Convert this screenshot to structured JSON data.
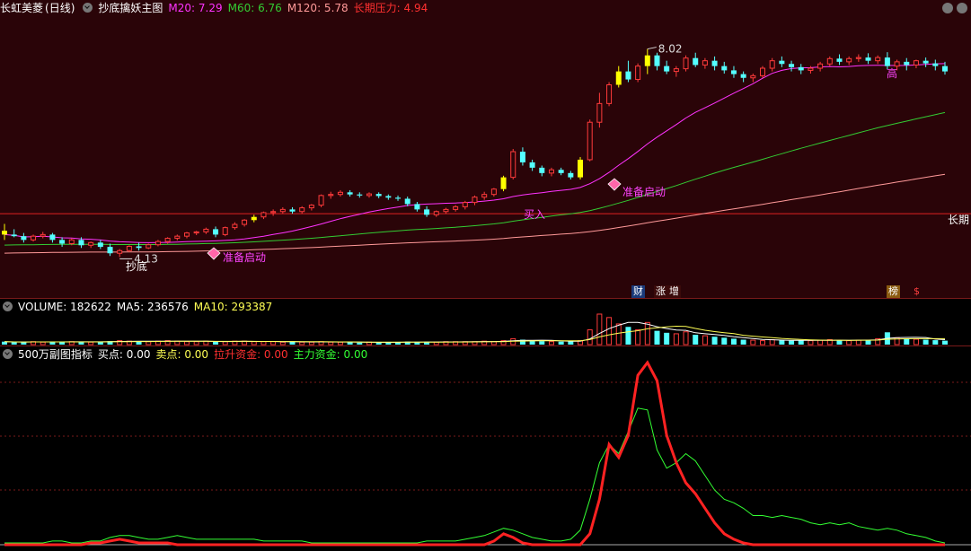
{
  "header": {
    "stock_name": "长虹美菱",
    "period": "(日线)",
    "indicator": "抄底擒妖主图",
    "m20": "M20: 7.29",
    "m60": "M60: 6.76",
    "m120": "M120: 5.78",
    "pressure": "长期压力: 4.94"
  },
  "volume_header": {
    "label": "VOLUME: 182622",
    "ma5": "MA5: 236576",
    "ma10": "MA10: 293387"
  },
  "sub_header": {
    "name": "500万副图指标",
    "buy": "买点: 0.00",
    "sell": "卖点: 0.00",
    "lift": "拉升资金: 0.00",
    "main": "主力资金: 0.00"
  },
  "annotations": {
    "high_label": "8.02",
    "low_label": "4.13",
    "chaodi": "抄底",
    "ready1": "准备启动",
    "ready2": "准备启动",
    "buy_in": "买入",
    "long_term": "长期",
    "gao": "高"
  },
  "badges": {
    "cai": "财",
    "zhang": "涨",
    "zeng": "增",
    "bang": "榜",
    "s": "$"
  },
  "colors": {
    "up": "#ff3b3b",
    "down": "#54ffff",
    "yellow": "#ffff00",
    "m20": "#ff33ff",
    "m60": "#33cc33",
    "m120": "#ff9999",
    "pressure": "#e02020",
    "main_fund": "#33ff33",
    "lift_fund": "#ff2222"
  },
  "chart_data": [
    {
      "type": "candlestick",
      "title": "抄底擒妖主图",
      "price_axis": [
        3.6,
        8.6
      ],
      "pressure_level": 4.94,
      "candles": [
        [
          4.62,
          4.75,
          4.55,
          4.45
        ],
        [
          4.55,
          4.65,
          4.52,
          4.5
        ],
        [
          4.52,
          4.58,
          4.45,
          4.4
        ],
        [
          4.45,
          4.55,
          4.52,
          4.42
        ],
        [
          4.52,
          4.6,
          4.55,
          4.48
        ],
        [
          4.55,
          4.58,
          4.45,
          4.4
        ],
        [
          4.45,
          4.5,
          4.38,
          4.32
        ],
        [
          4.38,
          4.48,
          4.45,
          4.35
        ],
        [
          4.45,
          4.5,
          4.35,
          4.3
        ],
        [
          4.35,
          4.42,
          4.4,
          4.3
        ],
        [
          4.4,
          4.45,
          4.32,
          4.28
        ],
        [
          4.32,
          4.38,
          4.2,
          4.15
        ],
        [
          4.2,
          4.28,
          4.25,
          4.13
        ],
        [
          4.25,
          4.35,
          4.33,
          4.22
        ],
        [
          4.33,
          4.4,
          4.3,
          4.25
        ],
        [
          4.3,
          4.38,
          4.36,
          4.28
        ],
        [
          4.36,
          4.45,
          4.42,
          4.33
        ],
        [
          4.42,
          4.5,
          4.48,
          4.38
        ],
        [
          4.48,
          4.55,
          4.52,
          4.44
        ],
        [
          4.52,
          4.6,
          4.58,
          4.48
        ],
        [
          4.58,
          4.62,
          4.6,
          4.54
        ],
        [
          4.6,
          4.68,
          4.65,
          4.56
        ],
        [
          4.65,
          4.7,
          4.55,
          4.5
        ],
        [
          4.55,
          4.7,
          4.68,
          4.52
        ],
        [
          4.68,
          4.78,
          4.74,
          4.64
        ],
        [
          4.74,
          4.84,
          4.82,
          4.7
        ],
        [
          4.82,
          4.92,
          4.88,
          4.78
        ],
        [
          4.88,
          4.98,
          4.96,
          4.84
        ],
        [
          4.96,
          5.02,
          4.98,
          4.9
        ],
        [
          4.98,
          5.06,
          5.02,
          4.94
        ],
        [
          5.02,
          5.06,
          4.98,
          4.94
        ],
        [
          4.98,
          5.08,
          5.05,
          4.94
        ],
        [
          5.05,
          5.12,
          5.1,
          5.0
        ],
        [
          5.1,
          5.3,
          5.28,
          5.06
        ],
        [
          5.28,
          5.35,
          5.3,
          5.22
        ],
        [
          5.3,
          5.38,
          5.34,
          5.26
        ],
        [
          5.34,
          5.38,
          5.3,
          5.26
        ],
        [
          5.3,
          5.34,
          5.28,
          5.24
        ],
        [
          5.28,
          5.34,
          5.31,
          5.24
        ],
        [
          5.31,
          5.34,
          5.27,
          5.23
        ],
        [
          5.27,
          5.3,
          5.24,
          5.2
        ],
        [
          5.24,
          5.28,
          5.22,
          5.18
        ],
        [
          5.22,
          5.26,
          5.12,
          5.08
        ],
        [
          5.12,
          5.16,
          5.02,
          4.98
        ],
        [
          5.02,
          5.08,
          4.92,
          4.88
        ],
        [
          4.92,
          5.0,
          4.98,
          4.88
        ],
        [
          4.98,
          5.05,
          5.02,
          4.94
        ],
        [
          5.02,
          5.1,
          5.07,
          4.98
        ],
        [
          5.07,
          5.18,
          5.15,
          5.02
        ],
        [
          5.15,
          5.28,
          5.25,
          5.1
        ],
        [
          5.25,
          5.35,
          5.3,
          5.2
        ],
        [
          5.3,
          5.42,
          5.4,
          5.26
        ],
        [
          5.4,
          5.65,
          5.62,
          5.36
        ],
        [
          5.62,
          6.15,
          6.1,
          5.58
        ],
        [
          6.1,
          6.18,
          5.9,
          5.84
        ],
        [
          5.9,
          5.95,
          5.8,
          5.74
        ],
        [
          5.8,
          5.84,
          5.7,
          5.64
        ],
        [
          5.7,
          5.8,
          5.76,
          5.64
        ],
        [
          5.76,
          5.8,
          5.7,
          5.66
        ],
        [
          5.7,
          5.74,
          5.62,
          5.58
        ],
        [
          5.62,
          6.0,
          5.95,
          5.58
        ],
        [
          5.95,
          6.7,
          6.65,
          5.92
        ],
        [
          6.65,
          7.2,
          7.0,
          6.55
        ],
        [
          7.0,
          7.4,
          7.35,
          6.95
        ],
        [
          7.35,
          7.7,
          7.6,
          7.3
        ],
        [
          7.6,
          7.8,
          7.45,
          7.4
        ],
        [
          7.45,
          7.75,
          7.7,
          7.4
        ],
        [
          7.7,
          8.02,
          7.9,
          7.55
        ],
        [
          7.9,
          7.95,
          7.7,
          7.62
        ],
        [
          7.7,
          7.8,
          7.6,
          7.55
        ],
        [
          7.6,
          7.7,
          7.65,
          7.5
        ],
        [
          7.65,
          7.9,
          7.85,
          7.6
        ],
        [
          7.85,
          7.95,
          7.72,
          7.68
        ],
        [
          7.72,
          7.85,
          7.8,
          7.65
        ],
        [
          7.8,
          7.88,
          7.7,
          7.62
        ],
        [
          7.7,
          7.78,
          7.62,
          7.56
        ],
        [
          7.62,
          7.7,
          7.55,
          7.48
        ],
        [
          7.55,
          7.6,
          7.48,
          7.4
        ],
        [
          7.48,
          7.56,
          7.52,
          7.4
        ],
        [
          7.52,
          7.7,
          7.66,
          7.48
        ],
        [
          7.66,
          7.85,
          7.8,
          7.6
        ],
        [
          7.8,
          7.88,
          7.74,
          7.68
        ],
        [
          7.74,
          7.8,
          7.68,
          7.6
        ],
        [
          7.68,
          7.74,
          7.62,
          7.55
        ],
        [
          7.62,
          7.7,
          7.66,
          7.56
        ],
        [
          7.66,
          7.78,
          7.74,
          7.6
        ],
        [
          7.74,
          7.88,
          7.84,
          7.7
        ],
        [
          7.84,
          7.92,
          7.78,
          7.72
        ],
        [
          7.78,
          7.88,
          7.84,
          7.72
        ],
        [
          7.84,
          7.92,
          7.86,
          7.78
        ],
        [
          7.86,
          7.94,
          7.8,
          7.74
        ],
        [
          7.8,
          7.9,
          7.86,
          7.74
        ],
        [
          7.86,
          7.96,
          7.7,
          7.64
        ],
        [
          7.7,
          7.82,
          7.78,
          7.62
        ],
        [
          7.78,
          7.85,
          7.72,
          7.62
        ],
        [
          7.72,
          7.82,
          7.8,
          7.66
        ],
        [
          7.8,
          7.86,
          7.75,
          7.68
        ],
        [
          7.75,
          7.82,
          7.7,
          7.62
        ],
        [
          7.7,
          7.78,
          7.6,
          7.54
        ]
      ]
    },
    {
      "type": "bar",
      "title": "VOLUME",
      "values": [
        0.06,
        0.05,
        0.05,
        0.06,
        0.05,
        0.06,
        0.05,
        0.06,
        0.06,
        0.05,
        0.06,
        0.07,
        0.08,
        0.07,
        0.06,
        0.06,
        0.07,
        0.08,
        0.07,
        0.06,
        0.06,
        0.07,
        0.06,
        0.06,
        0.07,
        0.07,
        0.06,
        0.06,
        0.06,
        0.05,
        0.06,
        0.05,
        0.05,
        0.06,
        0.05,
        0.05,
        0.05,
        0.04,
        0.05,
        0.04,
        0.05,
        0.05,
        0.06,
        0.05,
        0.05,
        0.05,
        0.06,
        0.06,
        0.06,
        0.06,
        0.07,
        0.06,
        0.08,
        0.12,
        0.1,
        0.08,
        0.07,
        0.06,
        0.06,
        0.07,
        0.08,
        0.3,
        0.62,
        0.55,
        0.42,
        0.36,
        0.3,
        0.45,
        0.28,
        0.24,
        0.22,
        0.26,
        0.2,
        0.18,
        0.16,
        0.14,
        0.12,
        0.1,
        0.09,
        0.08,
        0.1,
        0.09,
        0.08,
        0.09,
        0.08,
        0.09,
        0.1,
        0.09,
        0.08,
        0.09,
        0.1,
        0.12,
        0.25,
        0.14,
        0.12,
        0.11,
        0.1,
        0.09,
        0.08
      ]
    },
    {
      "type": "line",
      "title": "500万副图指标",
      "series": [
        {
          "name": "拉升资金",
          "values": [
            0.0,
            0.0,
            0.0,
            0.0,
            0.0,
            0.0,
            0.0,
            0.0,
            0.0,
            0.01,
            0.01,
            0.02,
            0.03,
            0.02,
            0.01,
            0.01,
            0.01,
            0.01,
            0.0,
            0.0,
            0.0,
            0.0,
            0.0,
            0.0,
            0.0,
            0.0,
            0.0,
            0.0,
            0.0,
            0.0,
            0.0,
            0.0,
            0.0,
            0.0,
            0.0,
            0.0,
            0.0,
            0.0,
            0.0,
            0.0,
            0.0,
            0.0,
            0.0,
            0.0,
            0.0,
            0.0,
            0.0,
            0.0,
            0.0,
            0.0,
            0.0,
            0.02,
            0.06,
            0.04,
            0.01,
            0.0,
            0.0,
            0.0,
            0.0,
            0.0,
            0.0,
            0.06,
            0.25,
            0.55,
            0.48,
            0.6,
            0.93,
            1.0,
            0.9,
            0.6,
            0.45,
            0.34,
            0.28,
            0.2,
            0.12,
            0.06,
            0.03,
            0.01,
            0.0,
            0.0,
            0.0,
            0.0,
            0.0,
            0.0,
            0.0,
            0.0,
            0.0,
            0.0,
            0.0,
            0.0,
            0.0,
            0.0,
            0.0,
            0.0,
            0.0,
            0.0,
            0.0,
            0.0,
            0.0
          ]
        },
        {
          "name": "主力资金",
          "values": [
            0.01,
            0.01,
            0.01,
            0.01,
            0.01,
            0.02,
            0.02,
            0.01,
            0.01,
            0.02,
            0.02,
            0.04,
            0.05,
            0.05,
            0.04,
            0.03,
            0.03,
            0.04,
            0.05,
            0.04,
            0.03,
            0.03,
            0.03,
            0.03,
            0.03,
            0.03,
            0.03,
            0.02,
            0.02,
            0.02,
            0.02,
            0.02,
            0.01,
            0.01,
            0.01,
            0.01,
            0.01,
            0.01,
            0.01,
            0.01,
            0.01,
            0.01,
            0.01,
            0.01,
            0.02,
            0.02,
            0.02,
            0.02,
            0.03,
            0.04,
            0.05,
            0.07,
            0.09,
            0.08,
            0.06,
            0.04,
            0.03,
            0.02,
            0.02,
            0.03,
            0.08,
            0.25,
            0.45,
            0.55,
            0.5,
            0.62,
            0.75,
            0.74,
            0.52,
            0.42,
            0.45,
            0.5,
            0.46,
            0.38,
            0.3,
            0.25,
            0.23,
            0.2,
            0.16,
            0.16,
            0.15,
            0.16,
            0.15,
            0.14,
            0.12,
            0.11,
            0.12,
            0.11,
            0.12,
            0.1,
            0.09,
            0.08,
            0.09,
            0.08,
            0.06,
            0.05,
            0.04,
            0.02,
            0.01
          ]
        }
      ]
    }
  ]
}
